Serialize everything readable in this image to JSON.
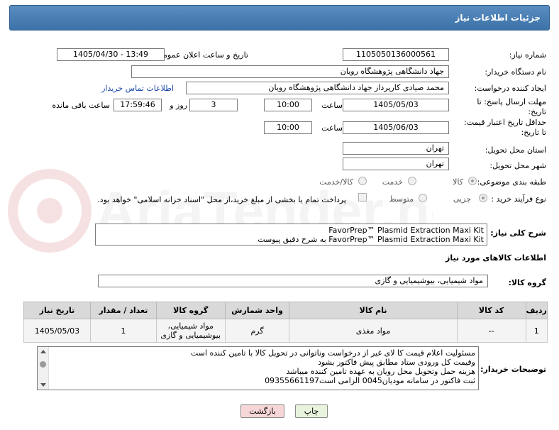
{
  "header": {
    "title": "جزئیات اطلاعات نیاز"
  },
  "form": {
    "need_number": {
      "label": "شماره نیاز:",
      "value": "1105050136000561"
    },
    "announce_datetime": {
      "label": "تاریخ و ساعت اعلان عمومی:",
      "value": "1405/04/30 - 13:49"
    },
    "buyer_org": {
      "label": "نام دستگاه خریدار:",
      "value": "جهاد دانشگاهی پژوهشگاه رویان"
    },
    "requester": {
      "label": "ایجاد کننده درخواست:",
      "value": "محمد صیادی کارپرداز جهاد دانشگاهی پژوهشگاه رویان",
      "contact_link": "اطلاعات تماس خریدار"
    },
    "reply_deadline": {
      "label_line1": "مهلت ارسال پاسخ: تا",
      "label_line2": "تاریخ:",
      "date": "1405/05/03",
      "time_label": "ساعت",
      "time": "10:00",
      "days": "3",
      "days_label": "روز و",
      "remaining": "17:59:46",
      "remaining_label": "ساعت باقی مانده"
    },
    "price_validity": {
      "label_line1": "حداقل تاریخ اعتبار قیمت:",
      "label_line2": "تا تاریخ:",
      "date": "1405/06/03",
      "time_label": "ساعت",
      "time": "10:00"
    },
    "province": {
      "label": "استان محل تحویل:",
      "value": "تهران"
    },
    "city": {
      "label": "شهر محل تحویل:",
      "value": "تهران"
    },
    "category": {
      "label": "طبقه بندی موضوعی:",
      "options": [
        "کالا",
        "خدمت",
        "کالا/خدمت"
      ],
      "selected": "کالا"
    },
    "process": {
      "label": "نوع فرآیند خرید :",
      "options": [
        "جزیی",
        "متوسط"
      ],
      "selected": "جزیی",
      "payment_note": "پرداخت تمام یا بخشی از مبلغ خرید،از محل \"اسناد خزانه اسلامی\" خواهد بود."
    }
  },
  "description": {
    "label": "شرح کلی نیاز:",
    "line1": "FavorPrep™ Plasmid Extraction Maxi Kit",
    "line2": "FavorPrep™ Plasmid Extraction Maxi Kit به شرح دقیق پیوست"
  },
  "goods_info": {
    "title": "اطلاعات کالاهای مورد نیاز",
    "group_label": "گروه کالا:",
    "group_value": "مواد شیمیایی، بیوشیمیایی و گازی"
  },
  "table": {
    "headers": [
      "ردیف",
      "کد کالا",
      "نام کالا",
      "واحد شمارش",
      "گروه کالا",
      "تعداد / مقدار",
      "تاریخ نیاز"
    ],
    "rows": [
      {
        "row": "1",
        "code": "--",
        "name": "مواد مغذی",
        "unit": "گرم",
        "group_line1": "مواد شیمیایی،",
        "group_line2": "بیوشیمیایی و گازی",
        "qty": "1",
        "date": "1405/05/03"
      }
    ]
  },
  "buyer_notes": {
    "label": "توضیحات خریدار:",
    "lines": [
      "مسئولیت اعلام قیمت کا لای  غیر از درخواست وناتوانی در تحویل کالا با تامین کننده است",
      "وقیمت کل ورودی ستاد مطابق پیش فاکتور بشود",
      "هزینه حمل وتحویل محل رویان به عهده تامین کننده میباشد",
      "ثبت فاکتور در سامانه مودیان0045 الزامی است09355661197"
    ]
  },
  "buttons": {
    "print": "چاپ",
    "back": "بازگشت"
  },
  "colors": {
    "header_bg": "#3c72a8",
    "link": "#1a47a8",
    "back_bg": "#f6d6d6",
    "print_bg": "#e7f3dc"
  },
  "watermark": "AriaTender.net"
}
